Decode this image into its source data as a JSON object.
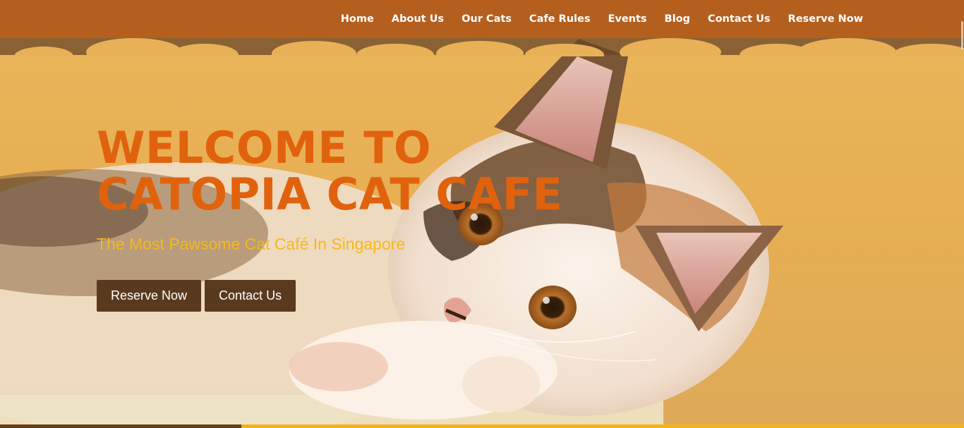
{
  "nav": {
    "items": [
      {
        "label": "Home"
      },
      {
        "label": "About Us"
      },
      {
        "label": "Our Cats"
      },
      {
        "label": "Cafe Rules"
      },
      {
        "label": "Events"
      },
      {
        "label": "Blog"
      },
      {
        "label": "Contact Us"
      },
      {
        "label": "Reserve Now"
      }
    ]
  },
  "hero": {
    "title_line1": "WELCOME TO",
    "title_line2": "CATOPIA CAT CAFE",
    "subtitle": "The Most Pawsome Cat Café In Singapore",
    "primary_button": "Reserve Now",
    "secondary_button": "Contact Us"
  },
  "colors": {
    "header_bg": "#b55f1f",
    "title": "#e1620d",
    "subtitle": "#f6b81c",
    "button_bg": "#5a3a1f"
  }
}
